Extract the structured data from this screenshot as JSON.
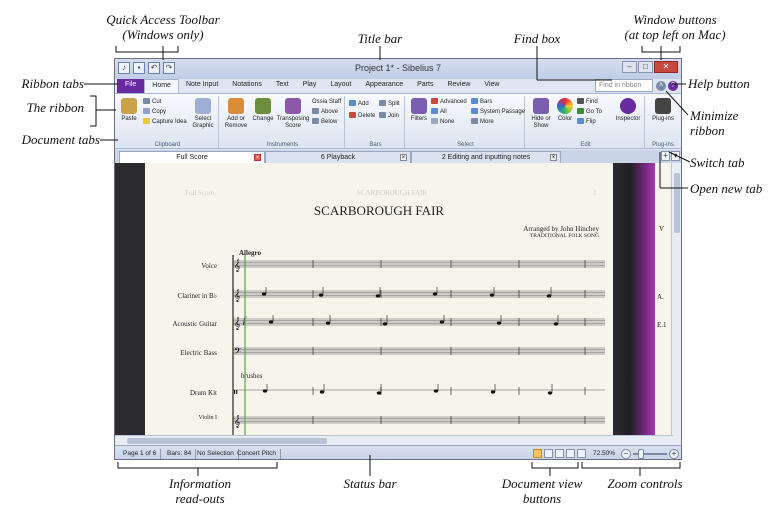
{
  "callouts": {
    "quick_access_toolbar": [
      "Quick Access Toolbar",
      "(Windows only)"
    ],
    "title_bar": "Title bar",
    "find_box": "Find box",
    "window_buttons": [
      "Window buttons",
      "(at top left on Mac)"
    ],
    "ribbon_tabs": "Ribbon tabs",
    "help_button": "Help button",
    "the_ribbon": "The ribbon",
    "minimize_ribbon": [
      "Minimize",
      "ribbon"
    ],
    "document_tabs": "Document tabs",
    "switch_tab": "Switch tab",
    "open_new_tab": "Open new tab",
    "information_readouts": [
      "Information",
      "read-outs"
    ],
    "status_bar": "Status bar",
    "document_view_buttons": [
      "Document view",
      "buttons"
    ],
    "zoom_controls": "Zoom controls"
  },
  "window": {
    "title": "Project 1* - Sibelius 7",
    "find_placeholder": "Find in ribbon"
  },
  "ribbon_tabs": [
    "File",
    "Home",
    "Note Input",
    "Notations",
    "Text",
    "Play",
    "Layout",
    "Appearance",
    "Parts",
    "Review",
    "View"
  ],
  "ribbon": {
    "clipboard": {
      "name": "Clipboard",
      "paste": "Paste",
      "cut": "Cut",
      "copy": "Copy",
      "capture_idea": "Capture Idea",
      "select_graphic": [
        "Select",
        "Graphic"
      ]
    },
    "instruments": {
      "name": "Instruments",
      "add_remove": [
        "Add or",
        "Remove"
      ],
      "change": "Change",
      "transposing_score": [
        "Transposing",
        "Score"
      ],
      "ossia_staff": "Ossia Staff",
      "above": "Above",
      "below": "Below"
    },
    "bars": {
      "name": "Bars",
      "add": "Add",
      "split": "Split",
      "delete": "Delete",
      "join": "Join"
    },
    "select": {
      "name": "Select",
      "filters": "Filters",
      "advanced": "Advanced",
      "all": "All",
      "none": "None",
      "bars": "Bars",
      "system_passage": "System Passage",
      "more": "More"
    },
    "edit": {
      "name": "Edit",
      "hide_or_show": [
        "Hide or",
        "Show"
      ],
      "color": "Color",
      "find": "Find",
      "go_to": "Go To",
      "flip": "Flip",
      "inspector": "Inspector"
    },
    "plugins": {
      "name": "Plug-ins",
      "plugins": "Plug-ins"
    }
  },
  "document_tabs": [
    {
      "label": "Full Score",
      "active": true
    },
    {
      "label": "6 Playback",
      "active": false
    },
    {
      "label": "2 Editing and inputting notes",
      "active": false
    }
  ],
  "score": {
    "header_left": "Full Score",
    "header_center": "SCARBOROUGH FAIR",
    "page_number": "1",
    "title": "SCARBOROUGH FAIR",
    "arranger": "Arranged by John Hinchey",
    "subtitle": "TRADITIONAL FOLK SONG",
    "tempo": "Allegro",
    "brushes_text": "brushes",
    "dynamic": "f",
    "instruments": [
      "Voice",
      "Clarinet in B♭",
      "Acoustic Guitar",
      "Electric Bass",
      "Drum Kit",
      "Violin I"
    ],
    "page2_labels": [
      "V",
      "A.",
      "E.1"
    ]
  },
  "status_bar": {
    "page": "Page 1 of 6",
    "bars": "Bars: 84",
    "selection": "No Selection",
    "pitch": "Concert Pitch",
    "zoom": "72.50%"
  }
}
